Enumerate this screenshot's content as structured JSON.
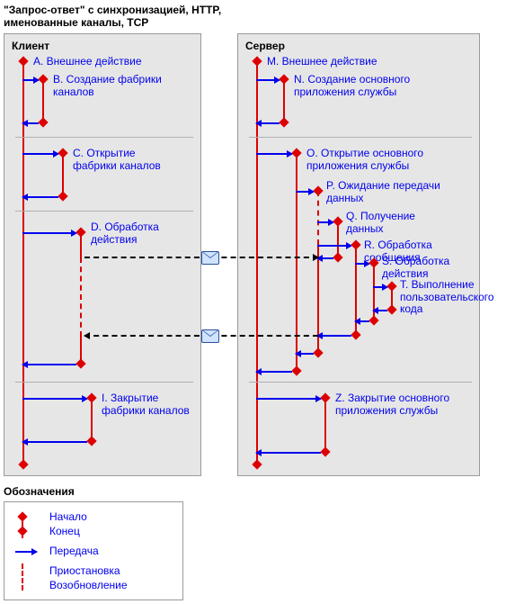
{
  "title": "\"Запрос-ответ\" с синхронизацией, HTTP,\nименованные каналы, TCP",
  "client": {
    "header": "Клиент",
    "A": "A. Внешнее действие",
    "B": "B. Создание фабрики каналов",
    "C": "C. Открытие фабрики каналов",
    "D": "D. Обработка действия",
    "I": "I. Закрытие фабрики каналов"
  },
  "server": {
    "header": "Сервер",
    "M": "M. Внешнее действие",
    "N": "N. Создание основного приложения службы",
    "O": "O. Открытие основного приложения службы",
    "P": "P. Ожидание передачи данных",
    "Q": "Q. Получение данных",
    "R": "R. Обработка сообщения",
    "S": "S. Обработка действия",
    "T": "T. Выполнение пользовательского кода",
    "Z": "Z. Закрытие основного приложения службы"
  },
  "legend": {
    "header": "Обозначения",
    "start": "Начало",
    "end": "Конец",
    "transfer": "Передача",
    "suspend": "Приостановка",
    "resume": "Возобновление"
  }
}
